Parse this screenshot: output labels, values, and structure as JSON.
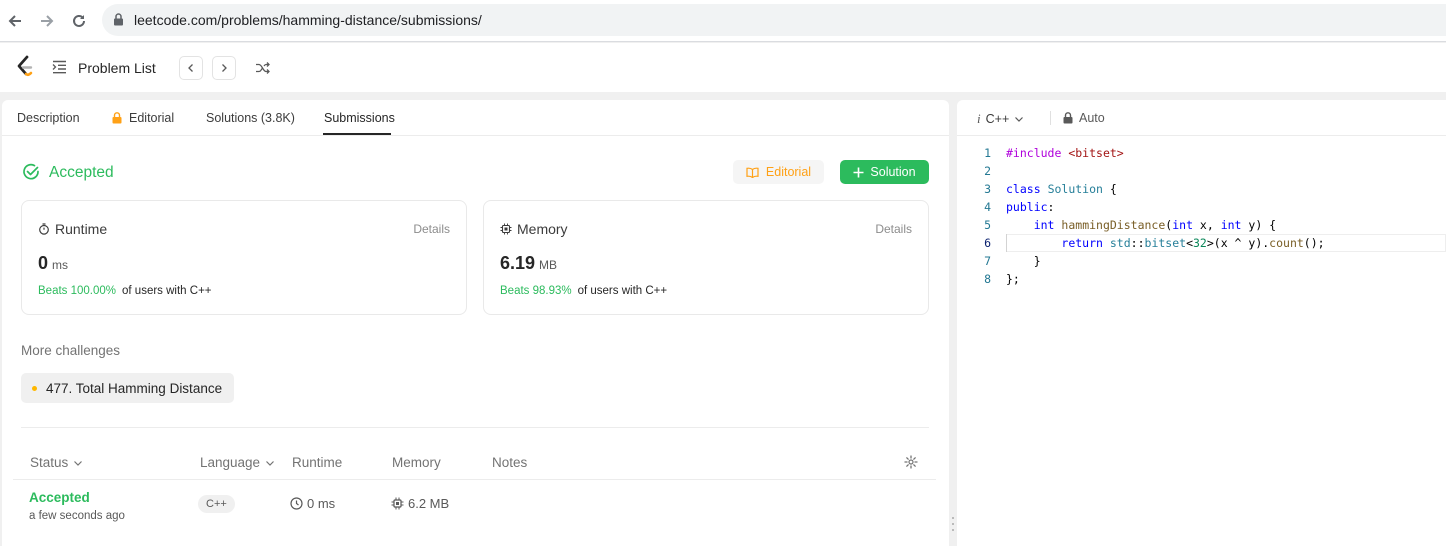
{
  "browser": {
    "url": "leetcode.com/problems/hamming-distance/submissions/"
  },
  "header": {
    "problem_list_label": "Problem List"
  },
  "tabs": [
    {
      "label": "Description"
    },
    {
      "label": "Editorial"
    },
    {
      "label": "Solutions (3.8K)"
    },
    {
      "label": "Submissions"
    }
  ],
  "result": {
    "status": "Accepted",
    "editorial_button": "Editorial",
    "solution_button": "Solution"
  },
  "runtime_card": {
    "title": "Runtime",
    "details": "Details",
    "value": "0",
    "unit": "ms",
    "beats": "Beats 100.00%",
    "beats_suffix": "of users with C++"
  },
  "memory_card": {
    "title": "Memory",
    "details": "Details",
    "value": "6.19",
    "unit": "MB",
    "beats": "Beats 98.93%",
    "beats_suffix": "of users with C++"
  },
  "challenges": {
    "title": "More challenges",
    "item": "477. Total Hamming Distance"
  },
  "table": {
    "headers": {
      "status": "Status",
      "language": "Language",
      "runtime": "Runtime",
      "memory": "Memory",
      "notes": "Notes"
    },
    "row": {
      "status": "Accepted",
      "time": "a few seconds ago",
      "language": "C++",
      "runtime": "0 ms",
      "memory": "6.2 MB"
    }
  },
  "editor": {
    "language": "C++",
    "auto_label": "Auto",
    "line_numbers": [
      "1",
      "2",
      "3",
      "4",
      "5",
      "6",
      "7",
      "8"
    ]
  },
  "colors": {
    "accent_green": "#2cbb5d",
    "editorial_orange": "#ffa116"
  }
}
